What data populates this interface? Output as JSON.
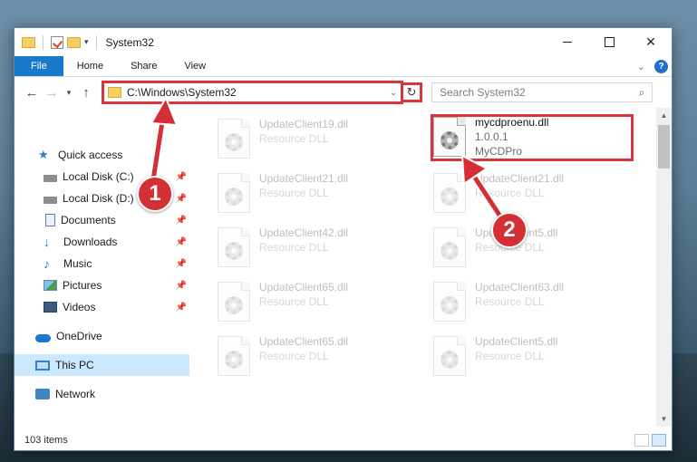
{
  "window": {
    "title": "System32"
  },
  "ribbon": {
    "tabs": [
      {
        "label": "File"
      },
      {
        "label": "Home"
      },
      {
        "label": "Share"
      },
      {
        "label": "View"
      }
    ],
    "help_glyph": "?"
  },
  "address": {
    "path": "C:\\Windows\\System32",
    "search_placeholder": "Search System32"
  },
  "nav": {
    "items": [
      {
        "label": "Quick access",
        "icon": "star-icon"
      },
      {
        "label": "Local Disk (C:)",
        "icon": "drive-icon",
        "pinned": true
      },
      {
        "label": "Local Disk (D:)",
        "icon": "drive-icon",
        "pinned": true
      },
      {
        "label": "Documents",
        "icon": "documents-icon",
        "pinned": true
      },
      {
        "label": "Downloads",
        "icon": "downloads-icon",
        "pinned": true
      },
      {
        "label": "Music",
        "icon": "music-icon",
        "pinned": true
      },
      {
        "label": "Pictures",
        "icon": "pictures-icon",
        "pinned": true
      },
      {
        "label": "Videos",
        "icon": "videos-icon",
        "pinned": true
      },
      {
        "label": "OneDrive",
        "icon": "onedrive-icon"
      },
      {
        "label": "This PC",
        "icon": "this-pc-icon",
        "selected": true
      },
      {
        "label": "Network",
        "icon": "network-icon"
      }
    ]
  },
  "files": {
    "left_column": [
      {
        "name": "UpdateClient19.dll",
        "type": "Resource DLL"
      },
      {
        "name": "UpdateClient21.dll",
        "type": "Resource DLL"
      },
      {
        "name": "UpdateClient42.dll",
        "type": "Resource DLL"
      },
      {
        "name": "UpdateClient65.dll",
        "type": "Resource DLL"
      },
      {
        "name": "UpdateClient65.dll",
        "type": "Resource DLL"
      }
    ],
    "right_column": [
      {
        "name": "mycdproenu.dll",
        "version": "1.0.0.1",
        "company": "MyCDPro",
        "highlighted": true
      },
      {
        "name": "UpdateClient21.dll",
        "type": "Resource DLL"
      },
      {
        "name": "UpdateClient5.dll",
        "type": "Resource DLL"
      },
      {
        "name": "UpdateClient63.dll",
        "type": "Resource DLL"
      },
      {
        "name": "UpdateClient5.dll",
        "type": "Resource DLL"
      }
    ]
  },
  "status": {
    "item_count": "103 items"
  },
  "annotations": {
    "step1": "1",
    "step2": "2",
    "color": "#d32f34"
  }
}
